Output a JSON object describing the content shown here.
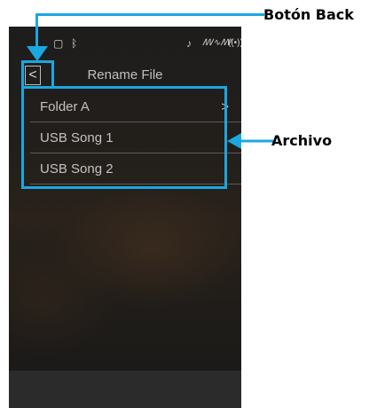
{
  "status_bar": {
    "usb_icon": "usb-icon",
    "bluetooth_icon": "bluetooth-icon",
    "mic_icon": "microphone-icon",
    "audio_icon": "audio-wave-icon",
    "wireless_icon": "wireless-icon"
  },
  "header": {
    "back_symbol": "<",
    "title": "Rename File"
  },
  "files": [
    {
      "label": "Folder A",
      "chevron": ">"
    },
    {
      "label": "USB Song 1"
    },
    {
      "label": "USB Song 2"
    }
  ],
  "callouts": {
    "back_label": "Botón Back",
    "files_label": "Archivo"
  },
  "colors": {
    "highlight": "#1ba7e0",
    "screen_background": "#1e1d1c",
    "text": "#c2c2c2"
  }
}
